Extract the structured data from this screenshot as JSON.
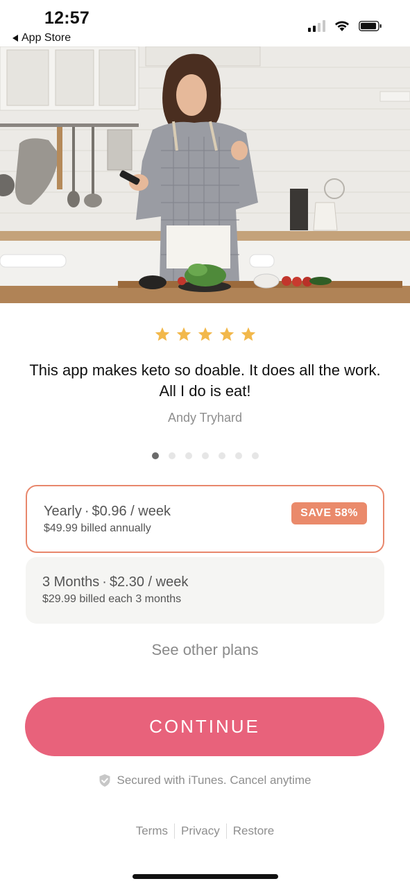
{
  "status_bar": {
    "time": "12:57",
    "back_label": "App Store",
    "signal_bars_active": 2,
    "signal_bars_total": 4
  },
  "hero": {
    "image_subject": "woman-cooking-in-kitchen"
  },
  "review": {
    "star_count": 5,
    "star_color": "#f2b84b",
    "quote": "This app makes keto so doable. It does all the work. All I do is eat!",
    "author": "Andy Tryhard",
    "carousel_dots_total": 7,
    "carousel_active_index": 0
  },
  "plans": [
    {
      "name": "Yearly",
      "price_per_week": "$0.96 / week",
      "billing": "$49.99 billed annually",
      "badge": "SAVE 58%",
      "selected": true
    },
    {
      "name": "3 Months",
      "price_per_week": "$2.30 / week",
      "billing": "$29.99 billed each 3 months",
      "selected": false
    }
  ],
  "other_plans_label": "See other plans",
  "continue_label": "CONTINUE",
  "secure_text": "Secured with iTunes. Cancel anytime",
  "footer": {
    "terms": "Terms",
    "privacy": "Privacy",
    "restore": "Restore"
  },
  "colors": {
    "accent": "#e8627b",
    "selected_border": "#e8876c",
    "badge": "#ea8a6b"
  }
}
